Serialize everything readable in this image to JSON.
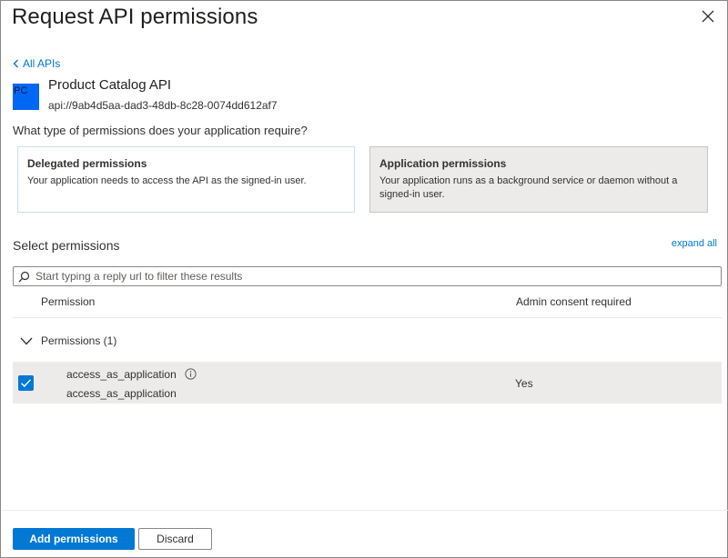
{
  "header": {
    "title": "Request API permissions"
  },
  "nav": {
    "back_label": "All APIs"
  },
  "api": {
    "logo_text": "PC",
    "logo_color": "#0067f5",
    "name": "Product Catalog API",
    "uri": "api://9ab4d5aa-dad3-48db-8c28-0074dd612af7"
  },
  "question": "What type of permissions does your application require?",
  "permission_types": [
    {
      "title": "Delegated permissions",
      "description": "Your application needs to access the API as the signed-in user.",
      "selected": false
    },
    {
      "title": "Application permissions",
      "description": "Your application runs as a background service or daemon without a signed-in user.",
      "selected": true
    }
  ],
  "select_permissions": {
    "heading": "Select permissions",
    "expand_all": "expand all",
    "filter_placeholder": "Start typing a reply url to filter these results",
    "columns": {
      "permission": "Permission",
      "admin_consent": "Admin consent required"
    },
    "group": {
      "label": "Permissions (1)",
      "expanded": true
    },
    "items": [
      {
        "name": "access_as_application",
        "description": "access_as_application",
        "admin_consent": "Yes",
        "checked": true
      }
    ]
  },
  "footer": {
    "primary_label": "Add permissions",
    "secondary_label": "Discard"
  },
  "colors": {
    "accent": "#0078d4",
    "selected_card_bg": "#edebe9",
    "row_bg": "#edebe9"
  }
}
